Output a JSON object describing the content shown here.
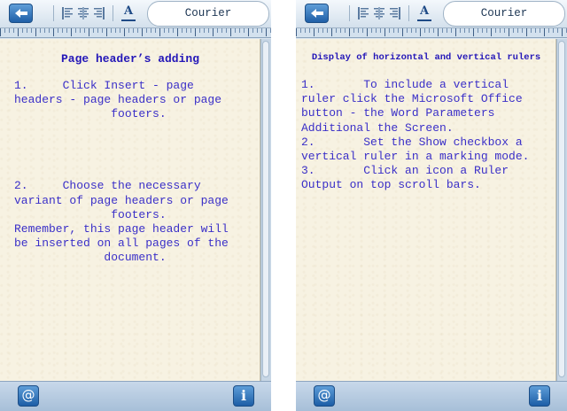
{
  "screens": [
    {
      "toolbar": {
        "back_icon": "back-arrow-icon",
        "align_icons": [
          "align-left-icon",
          "align-center-icon",
          "align-right-icon"
        ],
        "font_icon_glyph": "A",
        "font_name": "Courier"
      },
      "page": {
        "title": "Page header’s adding",
        "text": "1.     Click Insert - page\nheaders - page headers or page\n              footers.\n\n\n\n\n2.     Choose the necessary\nvariant of page headers or page\n              footers.\nRemember, this page header will\nbe inserted on all pages of the\n             document."
      },
      "bottombar": {
        "at_label": "@",
        "info_label": "i"
      }
    },
    {
      "toolbar": {
        "back_icon": "back-arrow-icon",
        "align_icons": [
          "align-left-icon",
          "align-center-icon",
          "align-right-icon"
        ],
        "font_icon_glyph": "A",
        "font_name": "Courier"
      },
      "page": {
        "title": "Display of horizontal and vertical rulers",
        "text": "1.       To include a vertical\nruler click the Microsoft Office\nbutton - the Word Parameters\nAdditional the Screen.\n2.       Set the Show checkbox a\nvertical ruler in a marking mode.\n3.       Click an icon a Ruler\nOutput on top scroll bars."
      },
      "bottombar": {
        "at_label": "@",
        "info_label": "i"
      }
    }
  ],
  "colors": {
    "accent_blue": "#1f5fa7",
    "text_blue": "#3a2fc8",
    "title_blue": "#2417b8",
    "paper": "#f7f2e2"
  }
}
